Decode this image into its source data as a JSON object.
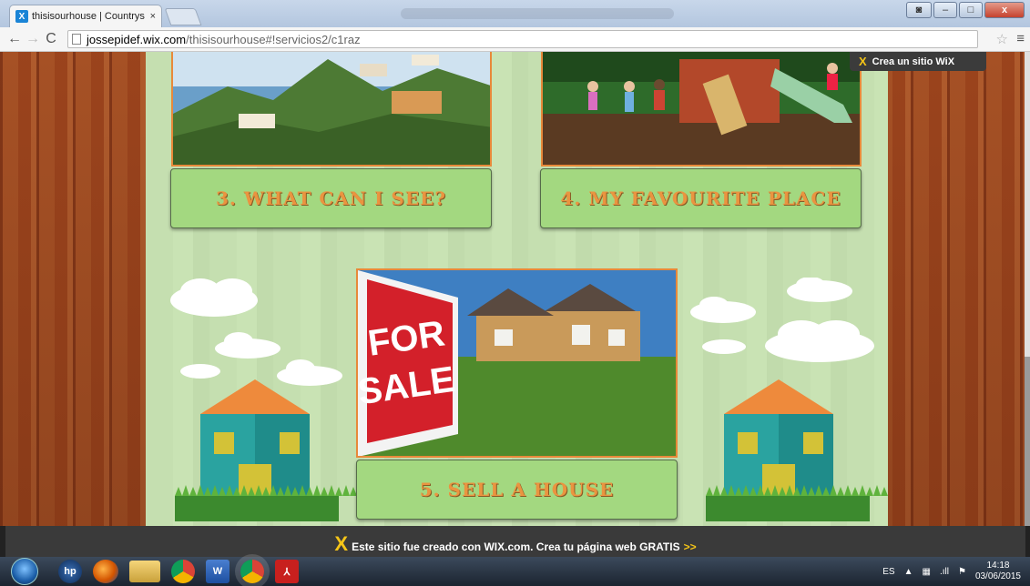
{
  "browser": {
    "tab_title": "thisisourhouse | Countrys",
    "tab_close": "×",
    "url_host": "jossepidef.wix.com",
    "url_path": "/thisisourhouse#!servicios2/c1raz",
    "back_icon": "back-arrow-icon",
    "forward_icon": "forward-arrow-icon",
    "reload_icon": "reload-icon"
  },
  "page": {
    "buttons": [
      {
        "label": "3. WHAT CAN I SEE?"
      },
      {
        "label": "4. MY FAVOURITE PLACE"
      },
      {
        "label": "5. SELL A HOUSE"
      }
    ],
    "sale_sign": {
      "line1": "FOR",
      "line2": "SALE"
    },
    "crea_wix": "Crea un sitio WiX"
  },
  "wix_footer": {
    "text": "Este sitio fue creado con WIX.com. Crea tu página web GRATIS",
    "arrows": ">>"
  },
  "taskbar": {
    "lang": "ES",
    "time": "14:18",
    "date": "03/06/2015"
  },
  "colors": {
    "button_bg": "#a3d880",
    "button_text": "#ea9440",
    "photo_border": "#e8893a",
    "wix_yellow": "#f5c518"
  }
}
